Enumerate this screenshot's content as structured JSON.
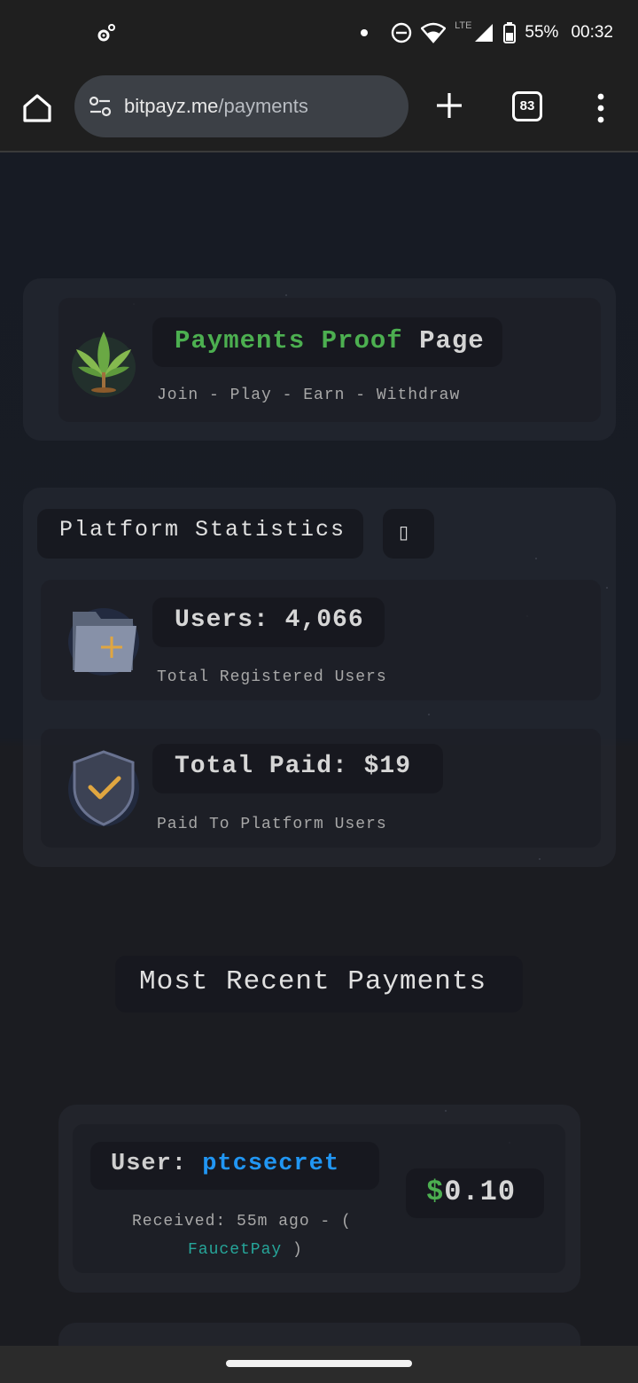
{
  "status_bar": {
    "battery": "55%",
    "time": "00:32",
    "network": "LTE"
  },
  "browser": {
    "url_domain": "bitpayz.me",
    "url_path": "/payments",
    "tab_count": "83"
  },
  "header": {
    "title_part1": "Payments",
    "title_part2": "Proof",
    "title_part3": "Page",
    "subtitle": "Join - Play - Earn - Withdraw"
  },
  "stats": {
    "heading": "Platform Statistics",
    "toggle_glyph": "▯",
    "users_value": "Users: 4,066",
    "users_caption": "Total Registered Users",
    "paid_value": "Total Paid: $19",
    "paid_caption": "Paid To Platform Users"
  },
  "recent": {
    "heading": "Most Recent Payments",
    "items": [
      {
        "user_label": "User:",
        "username": "ptcsecret",
        "received": "Received: 55m ago - (",
        "method": "FaucetPay",
        "close_paren": ")",
        "currency_symbol": "$",
        "amount": "0.10"
      }
    ]
  },
  "colors": {
    "accent_green": "#4caf50",
    "username_blue": "#2196f3",
    "method_teal": "#26a69a"
  }
}
